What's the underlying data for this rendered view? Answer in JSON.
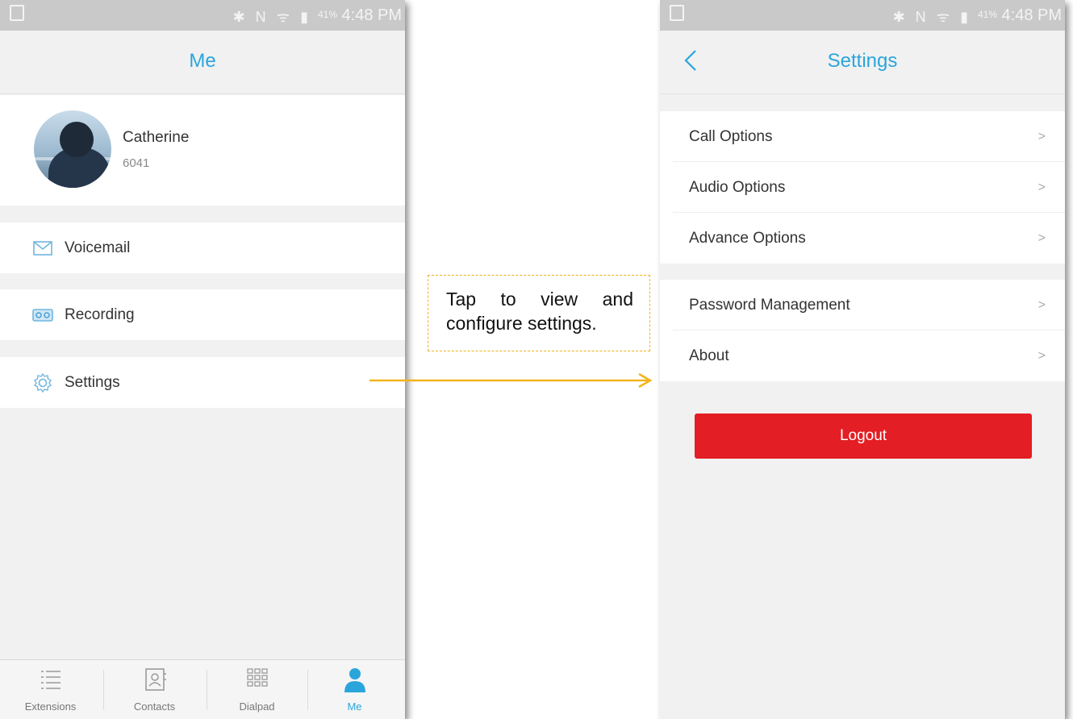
{
  "status_bar": {
    "battery": "41%",
    "time": "4:48 PM"
  },
  "left_screen": {
    "title": "Me",
    "profile": {
      "name": "Catherine",
      "extension": "6041"
    },
    "menu": [
      {
        "label": "Voicemail",
        "icon": "envelope-icon"
      },
      {
        "label": "Recording",
        "icon": "tape-icon"
      },
      {
        "label": "Settings",
        "icon": "gear-icon"
      }
    ],
    "bottom_nav": [
      {
        "label": "Extensions",
        "icon": "list-icon"
      },
      {
        "label": "Contacts",
        "icon": "contacts-icon"
      },
      {
        "label": "Dialpad",
        "icon": "dialpad-icon"
      },
      {
        "label": "Me",
        "icon": "person-icon",
        "active": true
      }
    ]
  },
  "right_screen": {
    "title": "Settings",
    "groups": [
      [
        "Call Options",
        "Audio Options",
        "Advance Options"
      ],
      [
        "Password Management",
        "About"
      ]
    ],
    "logout_label": "Logout"
  },
  "callout": {
    "line1_words": [
      "Tap",
      "to",
      "view",
      "and"
    ],
    "line2": "configure settings."
  },
  "colors": {
    "accent": "#2aa5dc",
    "logout": "#e31e24",
    "callout": "#f3b31a"
  }
}
